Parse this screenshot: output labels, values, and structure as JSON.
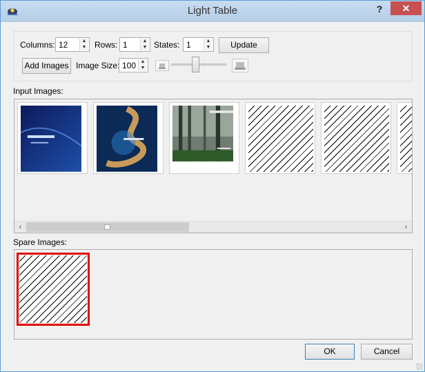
{
  "window": {
    "title": "Light Table",
    "help_label": "?",
    "close_label": "✕"
  },
  "toolbar": {
    "columns_label": "Columns:",
    "columns_value": "12",
    "rows_label": "Rows:",
    "rows_value": "1",
    "states_label": "States:",
    "states_value": "1",
    "update_label": "Update",
    "add_images_label": "Add Images",
    "image_size_label": "Image Size:",
    "image_size_value": "100",
    "image_size_slider_fraction": 0.45
  },
  "input_images": {
    "label": "Input Images:",
    "thumbnails": [
      {
        "kind": "image",
        "icon": "blue-softpedia-image"
      },
      {
        "kind": "image",
        "icon": "blue-swirl-image"
      },
      {
        "kind": "image",
        "icon": "forest-image"
      },
      {
        "kind": "empty",
        "icon": "placeholder-hatch"
      },
      {
        "kind": "empty",
        "icon": "placeholder-hatch"
      },
      {
        "kind": "empty",
        "icon": "placeholder-hatch"
      }
    ]
  },
  "spare_images": {
    "label": "Spare Images:",
    "selected_border_color": "#e00000"
  },
  "footer": {
    "ok_label": "OK",
    "cancel_label": "Cancel"
  },
  "colors": {
    "titlebar": "#b9d1ea",
    "close": "#c75050",
    "window_bg": "#f0f0f0"
  }
}
